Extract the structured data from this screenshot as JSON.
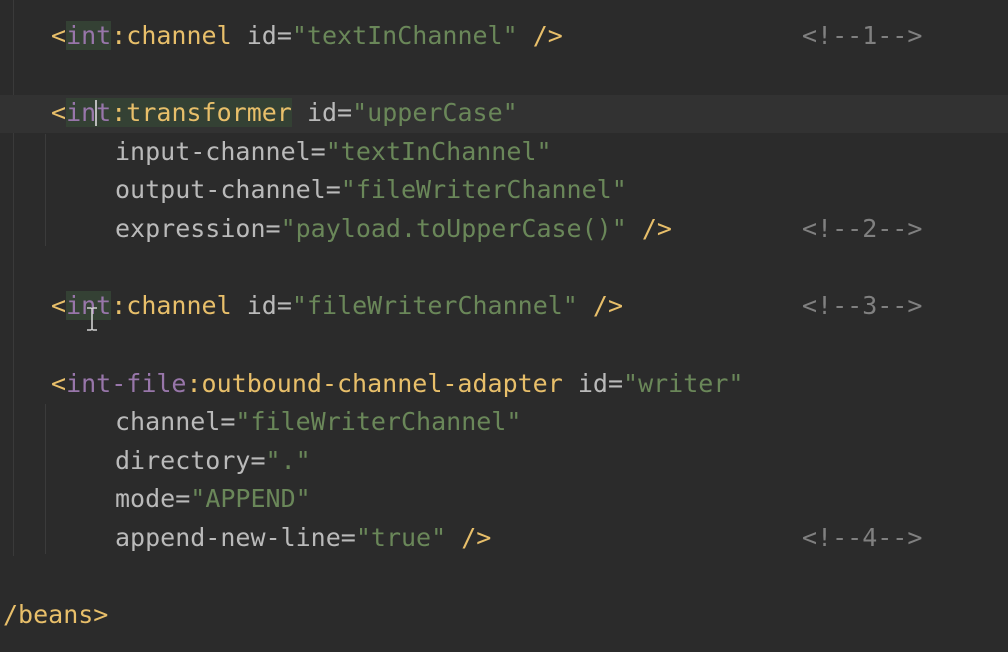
{
  "editor": {
    "line1": {
      "open": "<",
      "ns": "int",
      ":": ":",
      "tag": "channel",
      "attr": "id",
      "eq": "=",
      "val": "\"textInChannel\"",
      "close": " />",
      "comment": "<!--1-->"
    },
    "line2": {
      "open": "<",
      "ns_a": "in",
      "ns_b": "t",
      "colon": ":",
      "tag": "transformer",
      "attr": "id",
      "eq": "=",
      "val": "\"upperCase\""
    },
    "line3": {
      "attr": "input-channel",
      "eq": "=",
      "val": "\"textInChannel\""
    },
    "line4": {
      "attr": "output-channel",
      "eq": "=",
      "val": "\"fileWriterChannel\""
    },
    "line5": {
      "attr": "expression",
      "eq": "=",
      "val": "\"payload.toUpperCase()\"",
      "close": " />",
      "comment": "<!--2-->"
    },
    "line6": {
      "open": "<",
      "ns": "int",
      "colon": ":",
      "tag": "channel",
      "attr": "id",
      "eq": "=",
      "val": "\"fileWriterChannel\"",
      "close": " />",
      "comment": "<!--3-->"
    },
    "line7": {
      "open": "<",
      "ns": "int-file",
      "colon": ":",
      "tag": "outbound-channel-adapter",
      "attr": "id",
      "eq": "=",
      "val": "\"writer\""
    },
    "line8": {
      "attr": "channel",
      "eq": "=",
      "val": "\"fileWriterChannel\""
    },
    "line9": {
      "attr": "directory",
      "eq": "=",
      "val": "\".\""
    },
    "line10": {
      "attr": "mode",
      "eq": "=",
      "val": "\"APPEND\""
    },
    "line11": {
      "attr": "append-new-line",
      "eq": "=",
      "val": "\"true\"",
      "close": " />",
      "comment": "<!--4-->"
    },
    "line12": {
      "text": "/beans>"
    }
  },
  "colors": {
    "background": "#2b2b2b",
    "tag": "#e8bf6a",
    "namespace": "#9876aa",
    "attribute": "#bababa",
    "value": "#6a8759",
    "comment": "#808080"
  },
  "icons": {
    "cursor": "text-ibeam-cursor-icon"
  }
}
